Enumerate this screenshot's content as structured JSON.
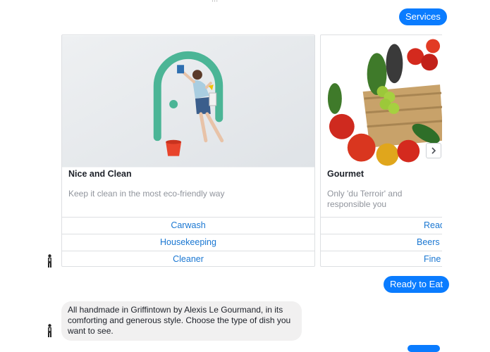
{
  "chat": {
    "top_partial_text": "...",
    "services_label": "Services",
    "ready_label": "Ready to Eat",
    "message_text": "All handmade in Griffintown by Alexis Le Gourmand, in its comforting and generous style. Choose the type of dish you want to see."
  },
  "cards": [
    {
      "title": "Nice and Clean",
      "subtitle": "Keep it clean in the most eco-friendly way",
      "buttons": [
        "Carwash",
        "Housekeeping",
        "Cleaner"
      ]
    },
    {
      "title": "Gourmet",
      "subtitle": "Only 'du Terroir' and responsible you",
      "buttons": [
        "Read",
        "Beers a",
        "Fine"
      ]
    }
  ],
  "icons": {
    "next": "chevron-right-icon",
    "avatar": "person-avatar-icon"
  },
  "colors": {
    "accent": "#0a7cff",
    "link": "#1a77d2",
    "arch": "#4bb596",
    "bubble": "#f1f0f0"
  }
}
